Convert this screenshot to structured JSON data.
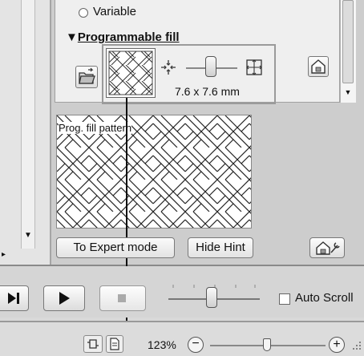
{
  "panel": {
    "variable_option": "Variable",
    "section_title_prefix": "▼",
    "section_title": "Programmable fill",
    "size_label": "7.6 x 7.6 mm",
    "preview_caption": "Prog. fill pattern",
    "expert_button": "To Expert mode",
    "hint_button": "Hide Hint"
  },
  "playback": {
    "auto_scroll_label": "Auto Scroll",
    "auto_scroll_checked": false,
    "slider_level": 0.55
  },
  "statusbar": {
    "zoom": "123%",
    "zoom_slider_level": 0.45
  },
  "colors": {
    "panel_bg": "#e7e7e7",
    "frame_bg": "#cfcfcf",
    "highlight_border": "#9a9a9a"
  }
}
